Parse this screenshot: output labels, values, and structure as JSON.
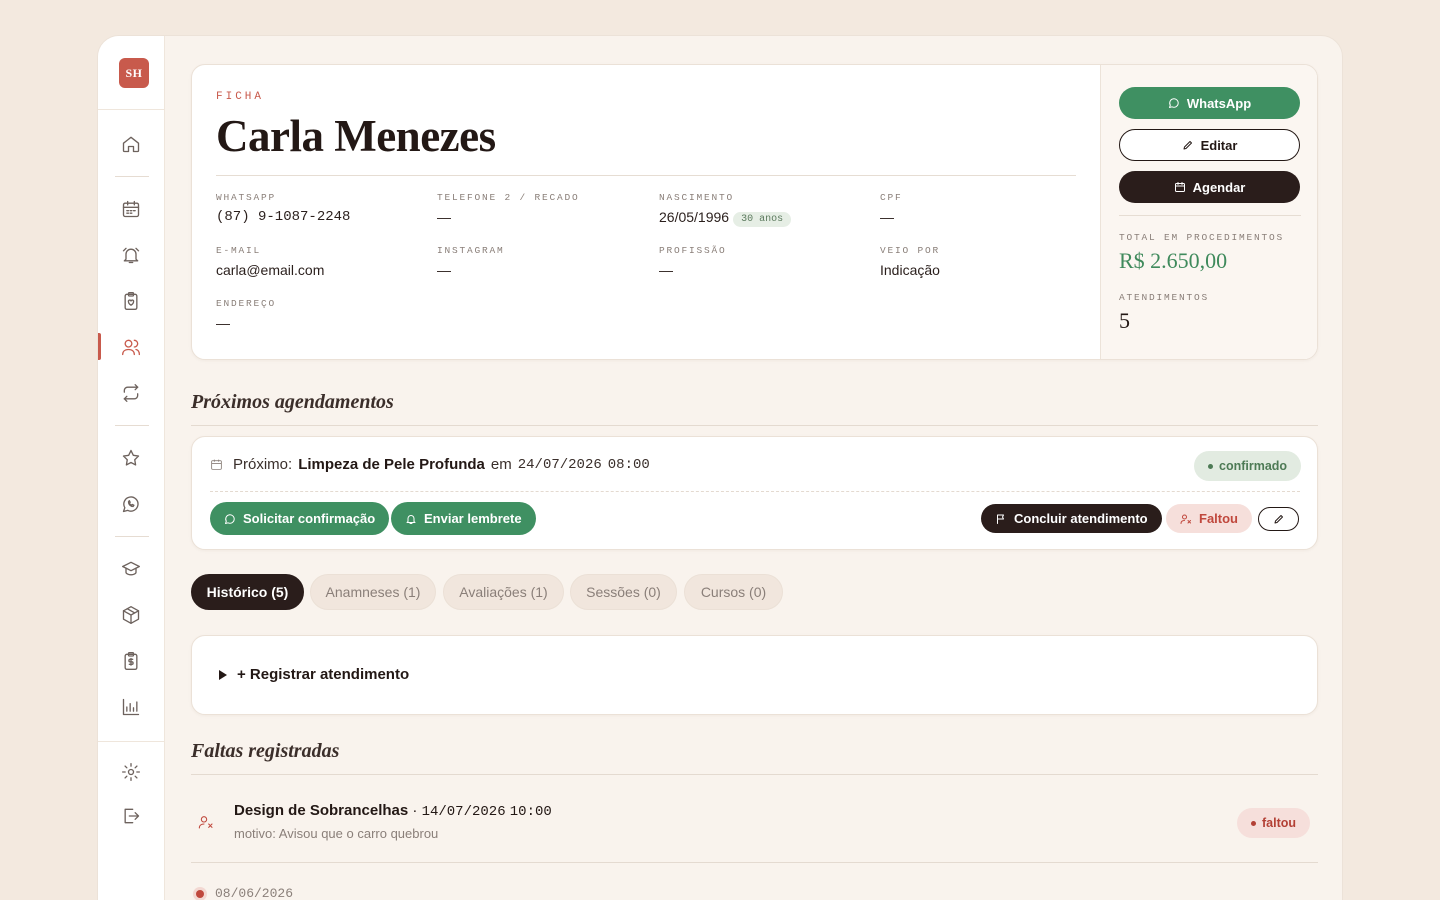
{
  "sidebar": {
    "logo": "SH",
    "icons": [
      "home-icon",
      "calendar-icon",
      "alarm-icon",
      "clipboard-heart-icon",
      "users-icon",
      "repeat-icon",
      "star-icon",
      "whatsapp-icon",
      "graduation-cap-icon",
      "box-icon",
      "clipboard-dollar-icon",
      "bar-chart-icon",
      "gear-icon",
      "logout-icon"
    ],
    "active": "users-icon"
  },
  "profile": {
    "eyebrow": "FICHA",
    "name": "Carla Menezes",
    "fields": {
      "whatsapp": {
        "label": "WHATSAPP",
        "value": "(87) 9-1087-2248"
      },
      "phone2": {
        "label": "TELEFONE 2 / RECADO",
        "value": "—"
      },
      "birth": {
        "label": "NASCIMENTO",
        "value": "26/05/1996",
        "age": "30 anos"
      },
      "cpf": {
        "label": "CPF",
        "value": "—"
      },
      "email": {
        "label": "E-MAIL",
        "value": "carla@email.com"
      },
      "instagram": {
        "label": "INSTAGRAM",
        "value": "—"
      },
      "profession": {
        "label": "PROFISSÃO",
        "value": "—"
      },
      "referral": {
        "label": "VEIO POR",
        "value": "Indicação"
      },
      "address": {
        "label": "ENDEREÇO",
        "value": "—"
      }
    },
    "actions": {
      "whatsapp": "WhatsApp",
      "edit": "Editar",
      "schedule": "Agendar"
    },
    "stats": {
      "total_label": "TOTAL EM PROCEDIMENTOS",
      "total_value": "R$ 2.650,00",
      "visits_label": "ATENDIMENTOS",
      "visits_value": "5"
    }
  },
  "upcoming": {
    "title": "Próximos agendamentos",
    "prefix": "Próximo:",
    "procedure": "Limpeza de Pele Profunda",
    "connector": "em",
    "date": "24/07/2026",
    "time": "08:00",
    "status": "confirmado",
    "buttons": {
      "request": "Solicitar confirmação",
      "remind": "Enviar lembrete",
      "complete": "Concluir atendimento",
      "missed": "Faltou"
    }
  },
  "tabs": [
    {
      "label": "Histórico (5)",
      "active": true
    },
    {
      "label": "Anamneses (1)",
      "active": false
    },
    {
      "label": "Avaliações (1)",
      "active": false
    },
    {
      "label": "Sessões (0)",
      "active": false
    },
    {
      "label": "Cursos (0)",
      "active": false
    }
  ],
  "register": {
    "label": "+ Registrar atendimento"
  },
  "absences": {
    "title": "Faltas registradas",
    "items": [
      {
        "procedure": "Design de Sobrancelhas",
        "separator": "·",
        "date": "14/07/2026",
        "time": "10:00",
        "reason": "motivo: Avisou que o carro quebrou",
        "status": "faltou"
      }
    ]
  },
  "history": {
    "first_date": "08/06/2026"
  },
  "colors": {
    "accent": "#c85a4c",
    "green": "#3f9062",
    "dark": "#2a1d1b",
    "background": "#f3e9df"
  }
}
